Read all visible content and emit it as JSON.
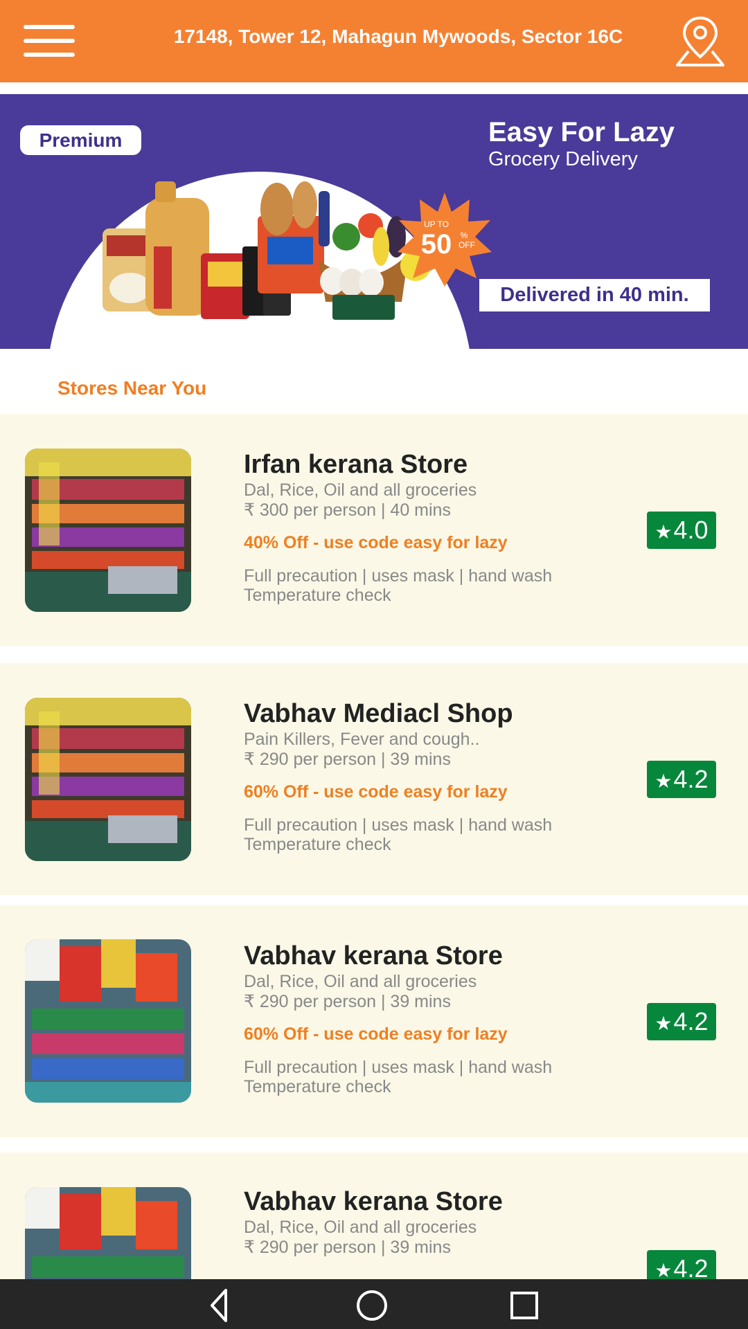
{
  "header": {
    "address": "17148, Tower 12, Mahagun Mywoods, Sector 16C",
    "menu_icon": "hamburger-menu-icon",
    "location_icon": "location-pin-icon",
    "bg_color": "#f48132"
  },
  "banner": {
    "badge": "Premium",
    "title": "Easy For Lazy",
    "subtitle": "Grocery Delivery",
    "offer_top": "UP TO",
    "offer_value": "50",
    "offer_percent": "%",
    "offer_suffix": "OFF",
    "delivery_text": "Delivered in 40 min.",
    "bg_color": "#4a3a99"
  },
  "section_title": "Stores Near You",
  "stores": [
    {
      "name": "Irfan kerana Store",
      "category": "Dal, Rice, Oil and all groceries",
      "price_time": "₹ 300 per person | 40 mins",
      "offer": "40% Off - use code easy for lazy",
      "precaution": "Full precaution | uses mask | hand wash",
      "precaution2": "Temperature check",
      "rating": "4.0"
    },
    {
      "name": "Vabhav Mediacl Shop",
      "category": "Pain Killers, Fever and cough..",
      "price_time": "₹ 290 per person | 39 mins",
      "offer": "60% Off - use code easy for lazy",
      "precaution": "Full precaution | uses mask | hand wash",
      "precaution2": "Temperature check",
      "rating": "4.2"
    },
    {
      "name": "Vabhav kerana Store",
      "category": "Dal, Rice, Oil and all groceries",
      "price_time": "₹ 290 per person | 39 mins",
      "offer": "60% Off - use code easy for lazy",
      "precaution": "Full precaution | uses mask | hand wash",
      "precaution2": "Temperature check",
      "rating": "4.2"
    },
    {
      "name": "Vabhav kerana Store",
      "category": "Dal, Rice, Oil and all groceries",
      "price_time": "₹ 290 per person | 39 mins",
      "rating": "4.2"
    }
  ],
  "rating_star": "★",
  "navbar": {
    "back_icon": "back-triangle-icon",
    "home_icon": "home-circle-icon",
    "recents_icon": "recents-square-icon"
  }
}
